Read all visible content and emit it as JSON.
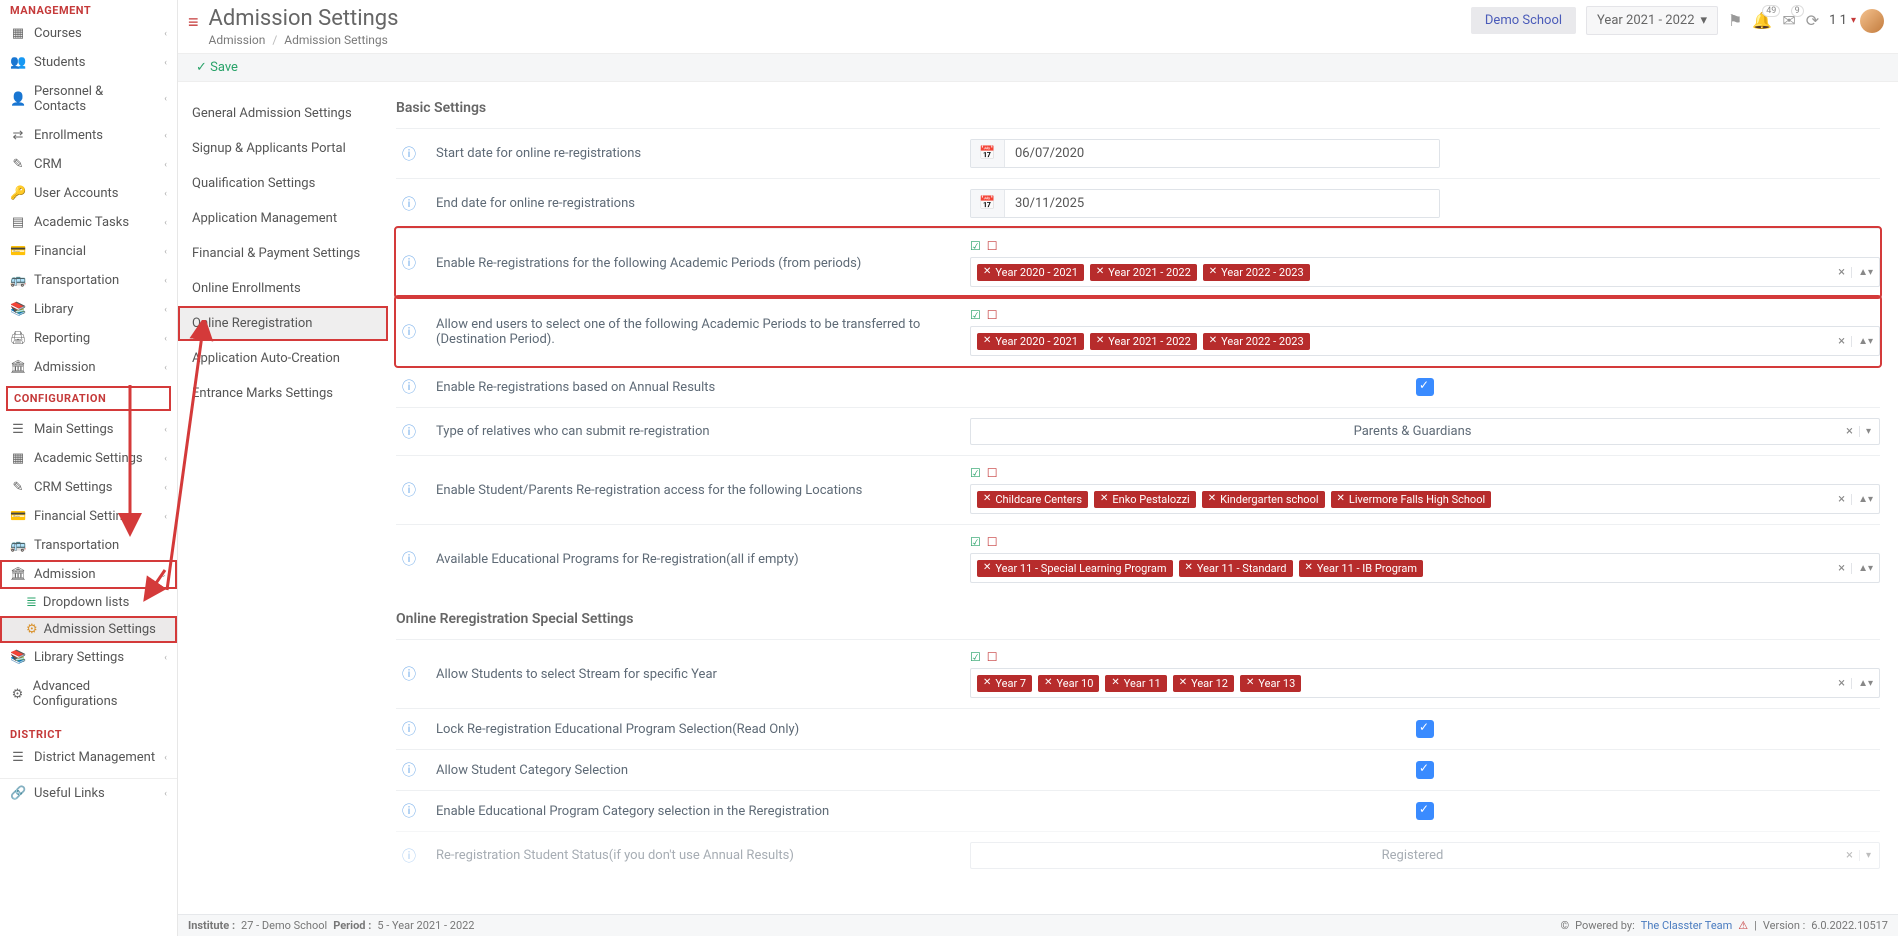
{
  "header": {
    "title": "Admission Settings",
    "crumb1": "Admission",
    "crumb2": "Admission Settings",
    "school": "Demo School",
    "year": "Year 2021 - 2022",
    "notif1": "49",
    "notif2": "9",
    "user": "1 1"
  },
  "save": "Save",
  "sidebar": {
    "sect_management": "MANAGEMENT",
    "items_mgmt": [
      "Courses",
      "Students",
      "Personnel & Contacts",
      "Enrollments",
      "CRM",
      "User Accounts",
      "Academic Tasks",
      "Financial",
      "Transportation",
      "Library",
      "Reporting",
      "Admission"
    ],
    "sect_config": "CONFIGURATION",
    "items_cfg": [
      "Main Settings",
      "Academic Settings",
      "CRM Settings",
      "Financial Settings",
      "Transportation",
      "Admission"
    ],
    "sub_dd": "Dropdown lists",
    "sub_adm": "Admission Settings",
    "lib": "Library Settings",
    "adv": "Advanced Configurations",
    "sect_district": "DISTRICT",
    "district": "District Management",
    "useful": "Useful Links"
  },
  "subnav": [
    "General Admission Settings",
    "Signup & Applicants Portal",
    "Qualification Settings",
    "Application Management",
    "Financial & Payment Settings",
    "Online Enrollments",
    "Online Reregistration",
    "Application Auto-Creation",
    "Entrance Marks Settings"
  ],
  "sections": {
    "basic": "Basic Settings",
    "special": "Online Reregistration Special Settings"
  },
  "rows": {
    "start": {
      "label": "Start date for online re-registrations",
      "value": "06/07/2020"
    },
    "end": {
      "label": "End date for online re-registrations",
      "value": "30/11/2025"
    },
    "fromPeriods": {
      "label": "Enable Re-registrations for the following Academic Periods (from periods)",
      "tags": [
        "Year 2020 - 2021",
        "Year 2021 - 2022",
        "Year 2022 - 2023"
      ]
    },
    "destPeriods": {
      "label": "Allow end users to select one of the following Academic Periods to be transferred to (Destination Period).",
      "tags": [
        "Year 2020 - 2021",
        "Year 2021 - 2022",
        "Year 2022 - 2023"
      ]
    },
    "annual": {
      "label": "Enable Re-registrations based on Annual Results"
    },
    "relatives": {
      "label": "Type of relatives who can submit re-registration",
      "value": "Parents & Guardians"
    },
    "locations": {
      "label": "Enable Student/Parents Re-registration access for the following Locations",
      "tags": [
        "Childcare Centers",
        "Enko Pestalozzi",
        "Kindergarten school",
        "Livermore Falls High School"
      ]
    },
    "programs": {
      "label": "Available Educational Programs for Re-registration(all if empty)",
      "tags": [
        "Year 11 - Special Learning Program",
        "Year 11 - Standard",
        "Year 11 - IB Program"
      ]
    },
    "streamYear": {
      "label": "Allow Students to select Stream for specific Year",
      "tags": [
        "Year 7",
        "Year 10",
        "Year 11",
        "Year 12",
        "Year 13"
      ]
    },
    "lockProg": {
      "label": "Lock Re-registration Educational Program Selection(Read Only)"
    },
    "allowCat": {
      "label": "Allow Student Category Selection"
    },
    "enableCat": {
      "label": "Enable Educational Program Category selection in the Reregistration"
    },
    "status": {
      "label": "Re-registration Student Status(if you don't use Annual Results)",
      "value": "Registered"
    }
  },
  "footer": {
    "inst_lbl": "Institute :",
    "inst_val": "27 - Demo School",
    "per_lbl": "Period :",
    "per_val": "5 - Year 2021 - 2022",
    "powered": "Powered by:",
    "team": "The Classter Team",
    "ver_lbl": "Version :",
    "ver_val": "6.0.2022.10517"
  }
}
